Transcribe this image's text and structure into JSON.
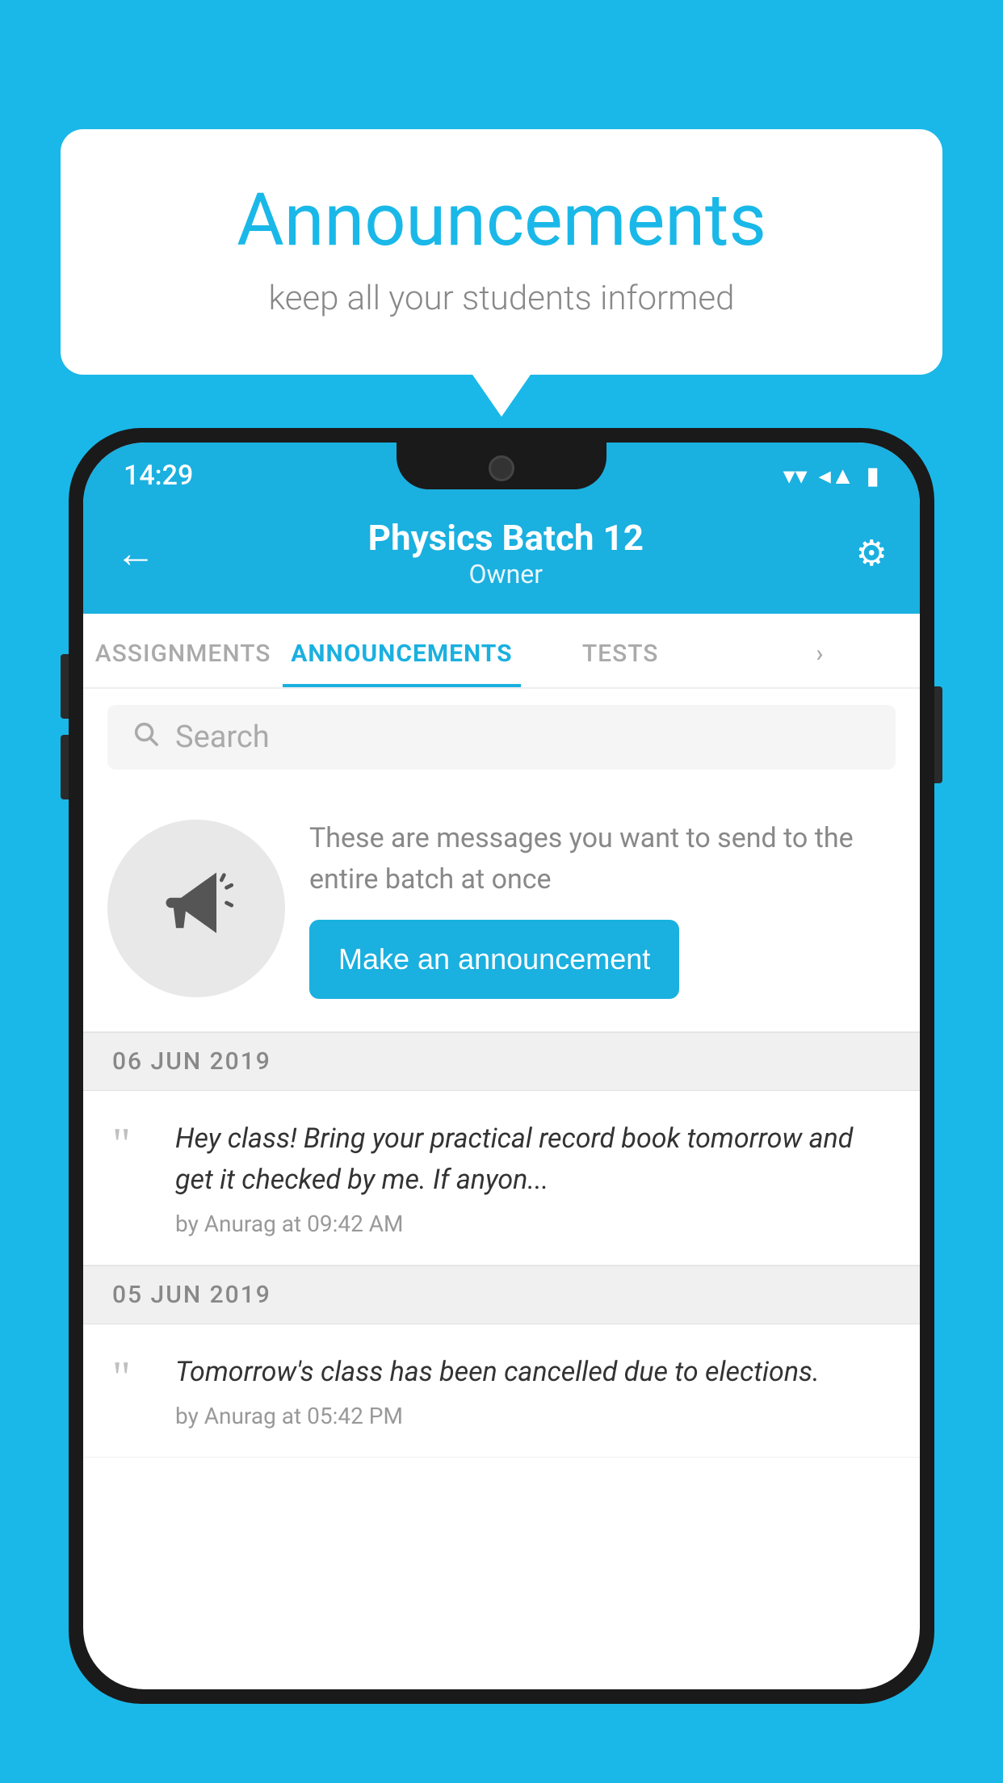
{
  "background_color": "#1ab8e8",
  "bubble": {
    "title": "Announcements",
    "subtitle": "keep all your students informed"
  },
  "status_bar": {
    "time": "14:29",
    "wifi_icon": "▾",
    "signal_icon": "◂",
    "battery_icon": "▮"
  },
  "header": {
    "back_label": "←",
    "title": "Physics Batch 12",
    "subtitle": "Owner",
    "settings_icon": "⚙"
  },
  "tabs": [
    {
      "label": "ASSIGNMENTS",
      "active": false
    },
    {
      "label": "ANNOUNCEMENTS",
      "active": true
    },
    {
      "label": "TESTS",
      "active": false
    },
    {
      "label": "›",
      "active": false
    }
  ],
  "search": {
    "placeholder": "Search"
  },
  "announce_prompt": {
    "description": "These are messages you want to send to the entire batch at once",
    "button_label": "Make an announcement"
  },
  "announcements": [
    {
      "date": "06  JUN  2019",
      "text": "Hey class! Bring your practical record book tomorrow and get it checked by me. If anyon...",
      "meta": "by Anurag at 09:42 AM"
    },
    {
      "date": "05  JUN  2019",
      "text": "Tomorrow's class has been cancelled due to elections.",
      "meta": "by Anurag at 05:42 PM"
    }
  ]
}
